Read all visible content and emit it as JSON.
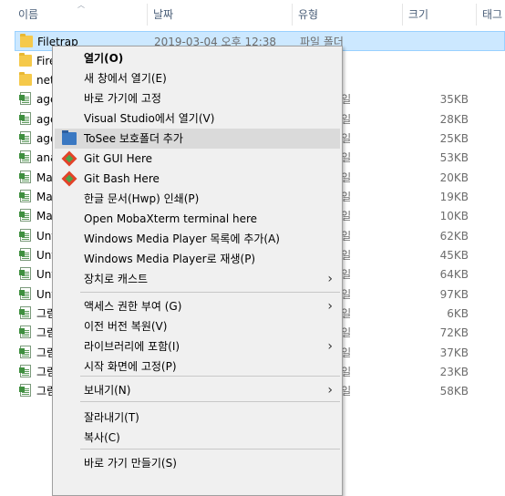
{
  "columns": [
    {
      "label": "이름"
    },
    {
      "label": "날짜"
    },
    {
      "label": "유형"
    },
    {
      "label": "크기"
    },
    {
      "label": "태그"
    }
  ],
  "files": [
    {
      "name": "Filetrap",
      "date": "2019-03-04 오후 12:38",
      "type": "파일 폴더",
      "size": "",
      "icon": "folder-icon",
      "selected": true
    },
    {
      "name": "Fire",
      "date": "",
      "type": "",
      "size": "",
      "icon": "folder-icon"
    },
    {
      "name": "net",
      "date": "",
      "type": "",
      "size": "",
      "icon": "folder-icon"
    },
    {
      "name": "age",
      "date": "",
      "type": "s 파일",
      "size": "35KB",
      "icon": "doc-icon"
    },
    {
      "name": "age",
      "date": "",
      "type": "s 파일",
      "size": "28KB",
      "icon": "doc-icon"
    },
    {
      "name": "age",
      "date": "",
      "type": "s 파일",
      "size": "25KB",
      "icon": "doc-icon"
    },
    {
      "name": "ana",
      "date": "",
      "type": "s 파일",
      "size": "53KB",
      "icon": "doc-icon"
    },
    {
      "name": "Ma",
      "date": "",
      "type": "s 파일",
      "size": "20KB",
      "icon": "doc-icon"
    },
    {
      "name": "Ma",
      "date": "",
      "type": "s 파일",
      "size": "19KB",
      "icon": "doc-icon"
    },
    {
      "name": "Ma",
      "date": "",
      "type": "s 파일",
      "size": "10KB",
      "icon": "doc-icon"
    },
    {
      "name": "Unt",
      "date": "",
      "type": "s 파일",
      "size": "62KB",
      "icon": "doc-icon"
    },
    {
      "name": "Unt",
      "date": "",
      "type": "s 파일",
      "size": "45KB",
      "icon": "doc-icon"
    },
    {
      "name": "Unt",
      "date": "",
      "type": "s 파일",
      "size": "64KB",
      "icon": "doc-icon"
    },
    {
      "name": "Unt",
      "date": "",
      "type": "s 파일",
      "size": "97KB",
      "icon": "doc-icon"
    },
    {
      "name": "그림",
      "date": "",
      "type": "s 파일",
      "size": "6KB",
      "icon": "doc-icon"
    },
    {
      "name": "그림",
      "date": "",
      "type": "s 파일",
      "size": "72KB",
      "icon": "doc-icon"
    },
    {
      "name": "그림",
      "date": "",
      "type": "s 파일",
      "size": "37KB",
      "icon": "doc-icon"
    },
    {
      "name": "그림",
      "date": "",
      "type": "s 파일",
      "size": "23KB",
      "icon": "doc-icon"
    },
    {
      "name": "그림",
      "date": "",
      "type": "s 파일",
      "size": "58KB",
      "icon": "doc-icon"
    }
  ],
  "context_menu": {
    "items": [
      {
        "label": "열기(O)",
        "bold": true
      },
      {
        "label": "새 창에서 열기(E)"
      },
      {
        "label": "바로 가기에 고정"
      },
      {
        "label": "Visual Studio에서 열기(V)"
      },
      {
        "label": "ToSee 보호폴더 추가",
        "icon": "tosee-folder-icon",
        "hover": true
      },
      {
        "label": "Git GUI Here",
        "icon": "git-icon"
      },
      {
        "label": "Git Bash Here",
        "icon": "git-icon"
      },
      {
        "label": "한글 문서(Hwp) 인쇄(P)"
      },
      {
        "label": "Open MobaXterm terminal here"
      },
      {
        "label": "Windows Media Player 목록에 추가(A)"
      },
      {
        "label": "Windows Media Player로 재생(P)"
      },
      {
        "label": "장치로 캐스트",
        "submenu": true
      },
      {
        "separator": true
      },
      {
        "label": "액세스 권한 부여 (G)",
        "submenu": true
      },
      {
        "label": "이전 버전 복원(V)"
      },
      {
        "label": "라이브러리에 포함(I)",
        "submenu": true
      },
      {
        "label": "시작 화면에 고정(P)"
      },
      {
        "separator": true
      },
      {
        "label": "보내기(N)",
        "submenu": true
      },
      {
        "separator": true
      },
      {
        "label": "잘라내기(T)"
      },
      {
        "label": "복사(C)"
      },
      {
        "separator": true
      },
      {
        "label": "바로 가기 만들기(S)"
      }
    ]
  },
  "colors": {
    "selection": "#cce8ff",
    "menu_bg": "#f0f0f0",
    "menu_hover": "#dadada"
  }
}
